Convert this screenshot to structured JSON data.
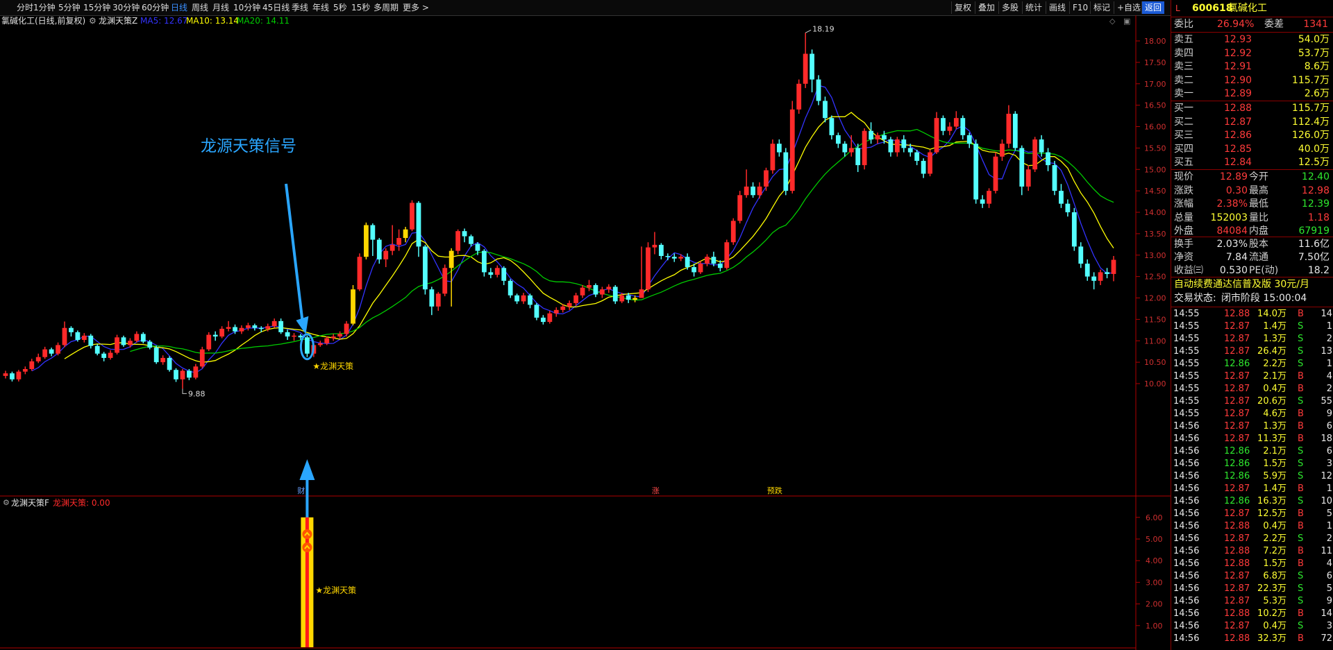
{
  "topbar": {
    "periods": [
      "分时",
      "1分钟",
      "5分钟",
      "15分钟",
      "30分钟",
      "60分钟",
      "日线",
      "周线",
      "月线",
      "10分钟",
      "45日线",
      "季线",
      "年线",
      "5秒",
      "15秒",
      "多周期",
      "更多 >"
    ],
    "active_period": "日线",
    "tools": [
      "复权",
      "叠加",
      "多股",
      "统计",
      "画线",
      "F10",
      "标记",
      "+自选",
      "返回"
    ]
  },
  "legend": {
    "title": "氯碱化工(日线,前复权)",
    "indicator": "龙渊天策Z",
    "ma5": "MA5: 12.67",
    "ma10": "MA10: 13.14",
    "ma20": "MA20: 14.11"
  },
  "annotation": {
    "text": "龙源天策信号"
  },
  "price_axis": {
    "ticks": [
      "18.00",
      "17.50",
      "17.00",
      "16.50",
      "16.00",
      "15.50",
      "15.00",
      "14.50",
      "14.00",
      "13.50",
      "13.00",
      "12.50",
      "12.00",
      "11.50",
      "11.00",
      "10.50",
      "10.00"
    ]
  },
  "markers": {
    "high": "18.19",
    "low": "9.88",
    "signal": "★龙渊天策",
    "events": [
      "财",
      "涨",
      "预跌"
    ]
  },
  "sub": {
    "title": "龙渊天策F",
    "value": "龙渊天策: 0.00",
    "signal": "★龙渊天策",
    "ticks": [
      "6.00",
      "5.00",
      "4.00",
      "3.00",
      "2.00",
      "1.00"
    ]
  },
  "colors": {
    "up": "#ff2a2a",
    "down": "#54ffff",
    "signal": "#ffd700",
    "ma5": "#3333ff",
    "ma10": "#ffff00",
    "ma20": "#00cc00"
  },
  "quote": {
    "code": "600618",
    "name": "氯碱化工",
    "weibi_label": "委比",
    "weibi": "26.94%",
    "weicha_label": "委差",
    "weicha": "1341",
    "asks": [
      {
        "label": "卖五",
        "price": "12.93",
        "vol": "54.0万"
      },
      {
        "label": "卖四",
        "price": "12.92",
        "vol": "53.7万"
      },
      {
        "label": "卖三",
        "price": "12.91",
        "vol": "8.6万"
      },
      {
        "label": "卖二",
        "price": "12.90",
        "vol": "115.7万"
      },
      {
        "label": "卖一",
        "price": "12.89",
        "vol": "2.6万"
      }
    ],
    "bids": [
      {
        "label": "买一",
        "price": "12.88",
        "vol": "115.7万"
      },
      {
        "label": "买二",
        "price": "12.87",
        "vol": "112.4万"
      },
      {
        "label": "买三",
        "price": "12.86",
        "vol": "126.0万"
      },
      {
        "label": "买四",
        "price": "12.85",
        "vol": "40.0万"
      },
      {
        "label": "买五",
        "price": "12.84",
        "vol": "12.5万"
      }
    ],
    "stats": [
      {
        "l1": "现价",
        "v1": "12.89",
        "c1": "red",
        "l2": "今开",
        "v2": "12.40",
        "c2": "green"
      },
      {
        "l1": "涨跌",
        "v1": "0.30",
        "c1": "red",
        "l2": "最高",
        "v2": "12.98",
        "c2": "red"
      },
      {
        "l1": "涨幅",
        "v1": "2.38%",
        "c1": "red",
        "l2": "最低",
        "v2": "12.39",
        "c2": "green"
      },
      {
        "l1": "总量",
        "v1": "152003",
        "c1": "yellow",
        "l2": "量比",
        "v2": "1.18",
        "c2": "red"
      },
      {
        "l1": "外盘",
        "v1": "84084",
        "c1": "red",
        "l2": "内盘",
        "v2": "67919",
        "c2": "green"
      }
    ],
    "stats2": [
      {
        "l1": "换手",
        "v1": "2.03%",
        "l2": "股本",
        "v2": "11.6亿"
      },
      {
        "l1": "净资",
        "v1": "7.84",
        "l2": "流通",
        "v2": "7.50亿"
      },
      {
        "l1": "收益㈢",
        "v1": "0.530",
        "l2": "PE(动)",
        "v2": "18.2"
      }
    ],
    "promo": "自动续费通达信普及版 30元/月",
    "status_label": "交易状态:",
    "status": "闭市阶段 15:00:04"
  },
  "ticks": [
    {
      "t": "14:55",
      "p": "12.88",
      "v": "14.0万",
      "s": "B",
      "n": "14"
    },
    {
      "t": "14:55",
      "p": "12.87",
      "v": "1.4万",
      "s": "S",
      "n": "1"
    },
    {
      "t": "14:55",
      "p": "12.87",
      "v": "1.3万",
      "s": "S",
      "n": "2"
    },
    {
      "t": "14:55",
      "p": "12.87",
      "v": "26.4万",
      "s": "S",
      "n": "13"
    },
    {
      "t": "14:55",
      "p": "12.86",
      "v": "2.2万",
      "s": "S",
      "n": "1"
    },
    {
      "t": "14:55",
      "p": "12.87",
      "v": "2.1万",
      "s": "B",
      "n": "4"
    },
    {
      "t": "14:55",
      "p": "12.87",
      "v": "0.4万",
      "s": "B",
      "n": "2"
    },
    {
      "t": "14:55",
      "p": "12.87",
      "v": "20.6万",
      "s": "S",
      "n": "55"
    },
    {
      "t": "14:55",
      "p": "12.87",
      "v": "4.6万",
      "s": "B",
      "n": "9"
    },
    {
      "t": "14:56",
      "p": "12.87",
      "v": "1.3万",
      "s": "B",
      "n": "6"
    },
    {
      "t": "14:56",
      "p": "12.87",
      "v": "11.3万",
      "s": "B",
      "n": "18"
    },
    {
      "t": "14:56",
      "p": "12.86",
      "v": "2.1万",
      "s": "S",
      "n": "6"
    },
    {
      "t": "14:56",
      "p": "12.86",
      "v": "1.5万",
      "s": "S",
      "n": "3"
    },
    {
      "t": "14:56",
      "p": "12.86",
      "v": "5.9万",
      "s": "S",
      "n": "12"
    },
    {
      "t": "14:56",
      "p": "12.87",
      "v": "1.4万",
      "s": "B",
      "n": "1"
    },
    {
      "t": "14:56",
      "p": "12.86",
      "v": "16.3万",
      "s": "S",
      "n": "10"
    },
    {
      "t": "14:56",
      "p": "12.87",
      "v": "12.5万",
      "s": "B",
      "n": "5"
    },
    {
      "t": "14:56",
      "p": "12.88",
      "v": "0.4万",
      "s": "B",
      "n": "1"
    },
    {
      "t": "14:56",
      "p": "12.87",
      "v": "2.2万",
      "s": "S",
      "n": "2"
    },
    {
      "t": "14:56",
      "p": "12.88",
      "v": "7.2万",
      "s": "B",
      "n": "11"
    },
    {
      "t": "14:56",
      "p": "12.88",
      "v": "1.5万",
      "s": "B",
      "n": "4"
    },
    {
      "t": "14:56",
      "p": "12.87",
      "v": "6.8万",
      "s": "S",
      "n": "6"
    },
    {
      "t": "14:56",
      "p": "12.87",
      "v": "22.3万",
      "s": "S",
      "n": "5"
    },
    {
      "t": "14:56",
      "p": "12.87",
      "v": "5.3万",
      "s": "S",
      "n": "9"
    },
    {
      "t": "14:56",
      "p": "12.88",
      "v": "10.2万",
      "s": "B",
      "n": "14"
    },
    {
      "t": "14:56",
      "p": "12.87",
      "v": "0.4万",
      "s": "S",
      "n": "3"
    },
    {
      "t": "14:56",
      "p": "12.88",
      "v": "32.3万",
      "s": "B",
      "n": "72"
    }
  ],
  "chart_data": {
    "type": "candlestick",
    "ylim": [
      9.6,
      18.4
    ],
    "sub_ylim": [
      0,
      7
    ],
    "candles": [
      [
        10.18,
        10.24,
        10.3,
        10.12
      ],
      [
        10.24,
        10.1,
        10.28,
        10.05
      ],
      [
        10.1,
        10.28,
        10.32,
        10.05
      ],
      [
        10.28,
        10.34,
        10.4,
        10.22
      ],
      [
        10.34,
        10.52,
        10.58,
        10.3
      ],
      [
        10.52,
        10.62,
        10.7,
        10.48
      ],
      [
        10.62,
        10.8,
        10.86,
        10.58
      ],
      [
        10.8,
        10.7,
        10.84,
        10.64
      ],
      [
        10.7,
        10.9,
        10.96,
        10.66
      ],
      [
        10.9,
        11.3,
        11.45,
        10.85
      ],
      [
        11.3,
        11.2,
        11.34,
        11.1
      ],
      [
        11.2,
        11.02,
        11.24,
        10.98
      ],
      [
        11.02,
        11.12,
        11.18,
        10.96
      ],
      [
        11.12,
        10.88,
        11.16,
        10.82
      ],
      [
        10.88,
        10.7,
        10.92,
        10.66
      ],
      [
        10.7,
        10.6,
        10.74,
        10.52
      ],
      [
        10.6,
        10.72,
        10.78,
        10.56
      ],
      [
        10.72,
        11.08,
        11.14,
        10.68
      ],
      [
        11.08,
        10.9,
        11.12,
        10.86
      ],
      [
        10.9,
        11.0,
        11.06,
        10.84
      ],
      [
        11.0,
        11.16,
        11.22,
        10.96
      ],
      [
        11.16,
        10.98,
        11.2,
        10.94
      ],
      [
        10.98,
        10.84,
        11.02,
        10.8
      ],
      [
        10.84,
        10.5,
        10.88,
        10.46
      ],
      [
        10.5,
        10.6,
        10.66,
        10.44
      ],
      [
        10.6,
        10.32,
        10.64,
        10.28
      ],
      [
        10.32,
        10.1,
        10.36,
        10.04
      ],
      [
        10.1,
        10.3,
        10.34,
        9.88
      ],
      [
        10.3,
        10.14,
        10.34,
        10.08
      ],
      [
        10.14,
        10.4,
        10.46,
        10.1
      ],
      [
        10.4,
        10.8,
        10.86,
        10.36
      ],
      [
        10.8,
        11.14,
        11.2,
        10.76
      ],
      [
        11.14,
        11.1,
        11.22,
        11.0
      ],
      [
        11.1,
        11.28,
        11.34,
        11.06
      ],
      [
        11.28,
        11.32,
        11.46,
        11.22
      ],
      [
        11.32,
        11.22,
        11.38,
        11.16
      ],
      [
        11.22,
        11.3,
        11.36,
        11.16
      ],
      [
        11.3,
        11.36,
        11.42,
        11.24
      ],
      [
        11.36,
        11.3,
        11.4,
        11.24
      ],
      [
        11.3,
        11.28,
        11.34,
        11.2
      ],
      [
        11.28,
        11.34,
        11.4,
        11.22
      ],
      [
        11.34,
        11.46,
        11.52,
        11.3
      ],
      [
        11.46,
        11.2,
        11.52,
        11.16
      ],
      [
        11.2,
        11.1,
        11.26,
        11.02
      ],
      [
        11.1,
        11.12,
        11.18,
        11.0
      ],
      [
        11.12,
        11.08,
        11.16,
        11.02
      ],
      [
        11.08,
        10.7,
        11.12,
        10.62
      ],
      [
        10.7,
        10.9,
        10.96,
        10.62
      ],
      [
        10.9,
        10.94,
        11.0,
        10.86
      ],
      [
        10.94,
        11.06,
        11.1,
        10.9
      ],
      [
        11.06,
        11.1,
        11.16,
        11.0
      ],
      [
        11.1,
        11.16,
        11.22,
        11.04
      ],
      [
        11.16,
        11.4,
        11.46,
        11.1
      ],
      [
        11.4,
        12.2,
        12.3,
        11.36
      ],
      [
        12.2,
        12.96,
        13.04,
        12.16
      ],
      [
        12.96,
        13.7,
        13.76,
        12.9
      ],
      [
        13.7,
        13.36,
        13.74,
        12.98
      ],
      [
        13.36,
        12.9,
        13.4,
        12.8
      ],
      [
        12.9,
        13.1,
        13.16,
        12.72
      ],
      [
        13.1,
        13.24,
        13.7,
        13.0
      ],
      [
        13.24,
        13.4,
        13.6,
        13.1
      ],
      [
        13.4,
        13.6,
        13.66,
        13.3
      ],
      [
        13.6,
        14.22,
        14.28,
        13.56
      ],
      [
        14.22,
        13.2,
        14.26,
        12.96
      ],
      [
        13.2,
        12.2,
        13.24,
        12.08
      ],
      [
        12.2,
        11.8,
        12.26,
        11.6
      ],
      [
        11.8,
        12.1,
        12.14,
        11.7
      ],
      [
        12.1,
        12.7,
        12.78,
        12.04
      ],
      [
        12.7,
        13.1,
        13.16,
        11.8
      ],
      [
        13.1,
        13.56,
        13.6,
        13.02
      ],
      [
        13.56,
        13.44,
        13.62,
        13.3
      ],
      [
        13.44,
        13.26,
        13.48,
        13.2
      ],
      [
        13.26,
        13.1,
        13.3,
        13.0
      ],
      [
        13.1,
        12.6,
        13.14,
        12.5
      ],
      [
        12.6,
        12.54,
        12.7,
        12.46
      ],
      [
        12.54,
        12.7,
        12.76,
        12.48
      ],
      [
        12.7,
        12.4,
        12.74,
        12.3
      ],
      [
        12.4,
        12.06,
        12.44,
        12.0
      ],
      [
        12.06,
        11.92,
        12.1,
        11.86
      ],
      [
        11.92,
        12.06,
        12.12,
        11.86
      ],
      [
        12.06,
        11.84,
        12.1,
        11.76
      ],
      [
        11.84,
        11.54,
        11.88,
        11.48
      ],
      [
        11.54,
        11.44,
        11.6,
        11.38
      ],
      [
        11.44,
        11.64,
        11.7,
        11.4
      ],
      [
        11.64,
        11.72,
        11.78,
        11.56
      ],
      [
        11.72,
        11.8,
        11.86,
        11.66
      ],
      [
        11.8,
        11.88,
        11.94,
        11.72
      ],
      [
        11.88,
        12.06,
        12.12,
        11.82
      ],
      [
        12.06,
        12.24,
        12.3,
        12.0
      ],
      [
        12.24,
        12.3,
        12.42,
        12.16
      ],
      [
        12.3,
        12.08,
        12.34,
        12.02
      ],
      [
        12.08,
        12.2,
        12.26,
        12.0
      ],
      [
        12.2,
        12.26,
        12.32,
        12.12
      ],
      [
        12.26,
        11.92,
        12.3,
        11.86
      ],
      [
        11.92,
        12.06,
        12.12,
        11.88
      ],
      [
        12.06,
        11.96,
        12.12,
        11.88
      ],
      [
        11.96,
        12.0,
        12.06,
        11.9
      ],
      [
        12.0,
        12.2,
        13.2,
        12.0
      ],
      [
        12.2,
        13.18,
        13.3,
        12.14
      ],
      [
        13.18,
        13.24,
        13.54,
        13.02
      ],
      [
        13.24,
        12.98,
        13.28,
        12.9
      ],
      [
        12.98,
        12.96,
        13.04,
        12.88
      ],
      [
        12.96,
        12.92,
        13.04,
        12.84
      ],
      [
        12.92,
        12.96,
        13.02,
        12.86
      ],
      [
        12.96,
        12.72,
        13.04,
        12.66
      ],
      [
        12.72,
        12.6,
        12.8,
        12.5
      ],
      [
        12.6,
        12.8,
        12.86,
        12.56
      ],
      [
        12.8,
        12.96,
        13.02,
        12.74
      ],
      [
        12.96,
        12.8,
        13.08,
        12.74
      ],
      [
        12.8,
        12.7,
        12.88,
        12.62
      ],
      [
        12.7,
        13.3,
        13.36,
        12.66
      ],
      [
        13.3,
        13.8,
        13.86,
        13.24
      ],
      [
        13.8,
        14.4,
        14.5,
        13.74
      ],
      [
        14.4,
        14.6,
        15.0,
        14.34
      ],
      [
        14.6,
        14.4,
        14.7,
        14.34
      ],
      [
        14.4,
        14.6,
        14.7,
        14.32
      ],
      [
        14.6,
        14.98,
        15.04,
        14.5
      ],
      [
        14.98,
        15.6,
        15.7,
        14.9
      ],
      [
        15.6,
        15.4,
        15.7,
        15.3
      ],
      [
        15.4,
        14.5,
        15.5,
        14.4
      ],
      [
        14.5,
        16.4,
        16.6,
        14.44
      ],
      [
        16.4,
        17.0,
        17.1,
        16.3
      ],
      [
        17.0,
        17.7,
        18.19,
        16.9
      ],
      [
        17.7,
        17.1,
        17.8,
        16.8
      ],
      [
        17.1,
        16.6,
        17.2,
        16.5
      ],
      [
        16.6,
        16.2,
        16.7,
        16.1
      ],
      [
        16.2,
        15.8,
        16.26,
        15.7
      ],
      [
        15.8,
        15.6,
        15.86,
        15.5
      ],
      [
        15.6,
        15.4,
        15.66,
        15.3
      ],
      [
        15.4,
        15.5,
        15.8,
        15.3
      ],
      [
        15.5,
        15.1,
        15.6,
        14.94
      ],
      [
        15.1,
        15.9,
        15.96,
        15.0
      ],
      [
        15.9,
        15.7,
        16.1,
        15.6
      ],
      [
        15.7,
        15.8,
        15.86,
        15.6
      ],
      [
        15.8,
        15.7,
        15.9,
        15.6
      ],
      [
        15.7,
        15.4,
        15.76,
        15.3
      ],
      [
        15.4,
        15.7,
        15.76,
        15.3
      ],
      [
        15.7,
        15.5,
        15.8,
        15.4
      ],
      [
        15.5,
        15.4,
        15.6,
        15.3
      ],
      [
        15.4,
        15.2,
        15.46,
        15.1
      ],
      [
        15.2,
        14.9,
        15.26,
        14.8
      ],
      [
        14.9,
        15.4,
        15.46,
        14.84
      ],
      [
        15.4,
        16.2,
        16.34,
        15.36
      ],
      [
        16.2,
        15.9,
        16.26,
        15.8
      ],
      [
        15.9,
        16.0,
        16.1,
        15.8
      ],
      [
        16.0,
        16.2,
        16.36,
        15.94
      ],
      [
        16.2,
        15.8,
        16.26,
        15.7
      ],
      [
        15.8,
        15.6,
        15.86,
        15.5
      ],
      [
        15.6,
        14.3,
        15.7,
        14.2
      ],
      [
        14.3,
        14.2,
        14.4,
        14.1
      ],
      [
        14.2,
        14.5,
        14.56,
        14.1
      ],
      [
        14.5,
        15.3,
        15.4,
        14.44
      ],
      [
        15.3,
        15.6,
        15.7,
        15.2
      ],
      [
        15.6,
        16.3,
        16.5,
        15.5
      ],
      [
        16.3,
        15.5,
        16.36,
        15.44
      ],
      [
        15.5,
        14.6,
        15.56,
        14.4
      ],
      [
        14.6,
        15.0,
        15.1,
        14.5
      ],
      [
        15.0,
        15.7,
        15.76,
        14.94
      ],
      [
        15.7,
        15.4,
        15.8,
        15.3
      ],
      [
        15.4,
        15.1,
        15.5,
        14.96
      ],
      [
        15.1,
        14.5,
        15.2,
        14.4
      ],
      [
        14.5,
        14.2,
        14.66,
        14.1
      ],
      [
        14.2,
        14.0,
        14.3,
        13.9
      ],
      [
        14.0,
        13.2,
        14.1,
        13.1
      ],
      [
        13.2,
        12.8,
        13.3,
        12.7
      ],
      [
        12.8,
        12.5,
        12.9,
        12.4
      ],
      [
        12.5,
        12.4,
        12.6,
        12.2
      ],
      [
        12.4,
        12.6,
        12.66,
        12.3
      ],
      [
        12.6,
        12.56,
        12.7,
        12.46
      ],
      [
        12.56,
        12.89,
        12.98,
        12.39
      ]
    ],
    "signal_index": 46,
    "sub_signal": 6.0
  }
}
